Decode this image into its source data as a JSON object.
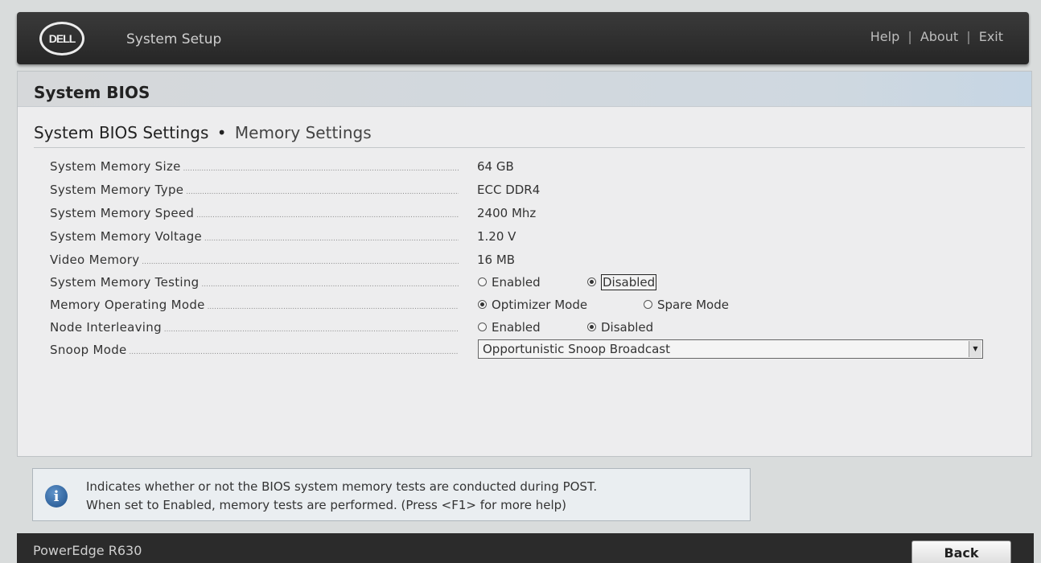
{
  "header": {
    "logo_text": "DELL",
    "app_title": "System Setup",
    "links": {
      "help": "Help",
      "about": "About",
      "exit": "Exit"
    },
    "separator": "|"
  },
  "panel": {
    "section_title": "System BIOS",
    "breadcrumb": {
      "parent": "System BIOS Settings",
      "separator": "•",
      "current": "Memory Settings"
    }
  },
  "settings": {
    "memory_size": {
      "label": "System Memory Size",
      "value": "64 GB"
    },
    "memory_type": {
      "label": "System Memory Type",
      "value": "ECC DDR4"
    },
    "memory_speed": {
      "label": "System Memory Speed",
      "value": "2400 Mhz"
    },
    "memory_voltage": {
      "label": "System Memory Voltage",
      "value": "1.20 V"
    },
    "video_memory": {
      "label": "Video Memory",
      "value": "16 MB"
    },
    "memory_testing": {
      "label": "System Memory Testing",
      "options": [
        "Enabled",
        "Disabled"
      ],
      "selected": "Disabled"
    },
    "operating_mode": {
      "label": "Memory Operating Mode",
      "options": [
        "Optimizer Mode",
        "Spare Mode"
      ],
      "selected": "Optimizer Mode"
    },
    "node_interleaving": {
      "label": "Node Interleaving",
      "options": [
        "Enabled",
        "Disabled"
      ],
      "selected": "Disabled"
    },
    "snoop_mode": {
      "label": "Snoop Mode",
      "selected": "Opportunistic Snoop Broadcast"
    }
  },
  "help": {
    "line1": "Indicates whether or not the BIOS system memory tests are conducted during POST.",
    "line2": "When set to Enabled, memory tests are performed. (Press <F1> for more help)"
  },
  "footer": {
    "model": "PowerEdge R630",
    "back_label": "Back"
  },
  "icons": {
    "info": "info-icon",
    "dropdown": "chevron-down-icon"
  }
}
